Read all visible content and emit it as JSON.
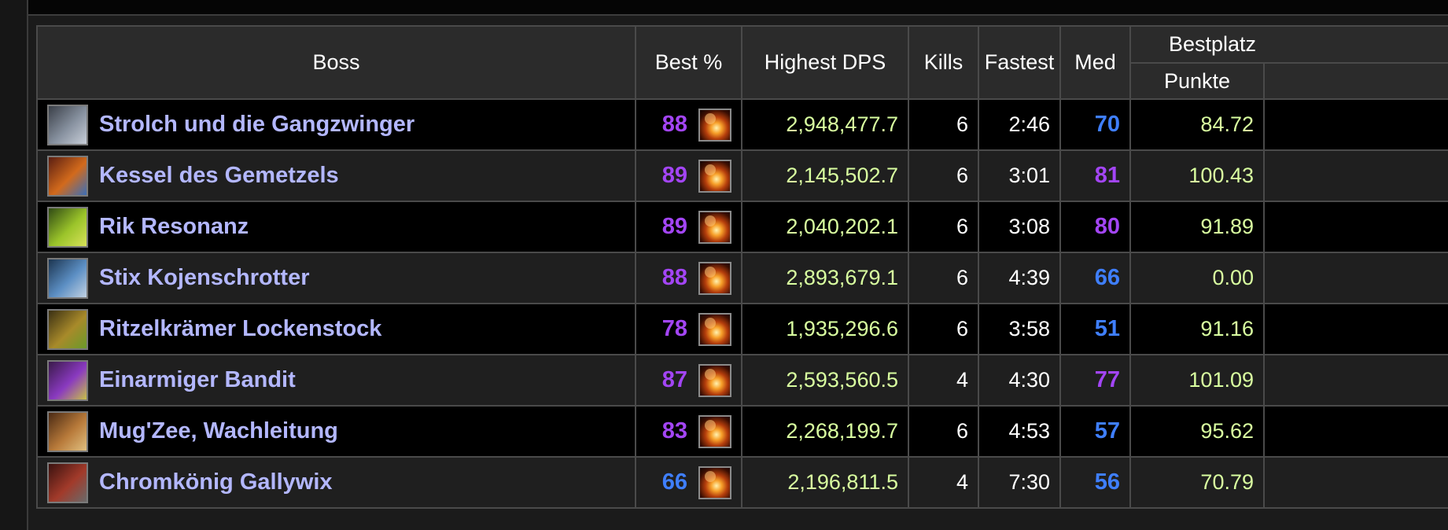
{
  "headers": {
    "boss": "Boss",
    "best_pct": "Best %",
    "highest_dps": "Highest DPS",
    "kills": "Kills",
    "fastest": "Fastest",
    "med": "Med",
    "bestplatz": "Bestplatz",
    "punkte": "Punkte"
  },
  "colors": {
    "purple": "#a345f5",
    "blue": "#3f7fff",
    "name": "#b3b7ff",
    "value": "#d9ffa0"
  },
  "rows": [
    {
      "boss": "Strolch und die Gangzwinger",
      "icon": "boss-portrait-icon",
      "best": "88",
      "best_color": "purple",
      "spell_icon": "fire-spell-icon",
      "dps": "2,948,477.7",
      "kills": "6",
      "fastest": "2:46",
      "med": "70",
      "med_color": "blue",
      "punkte": "84.72"
    },
    {
      "boss": "Kessel des Gemetzels",
      "icon": "boss-portrait-icon",
      "best": "89",
      "best_color": "purple",
      "spell_icon": "fire-spell-icon",
      "dps": "2,145,502.7",
      "kills": "6",
      "fastest": "3:01",
      "med": "81",
      "med_color": "purple",
      "punkte": "100.43"
    },
    {
      "boss": "Rik Resonanz",
      "icon": "boss-portrait-icon",
      "best": "89",
      "best_color": "purple",
      "spell_icon": "fire-spell-icon",
      "dps": "2,040,202.1",
      "kills": "6",
      "fastest": "3:08",
      "med": "80",
      "med_color": "purple",
      "punkte": "91.89"
    },
    {
      "boss": "Stix Kojenschrotter",
      "icon": "boss-portrait-icon",
      "best": "88",
      "best_color": "purple",
      "spell_icon": "fire-spell-icon",
      "dps": "2,893,679.1",
      "kills": "6",
      "fastest": "4:39",
      "med": "66",
      "med_color": "blue",
      "punkte": "0.00"
    },
    {
      "boss": "Ritzelkrämer Lockenstock",
      "icon": "boss-portrait-icon",
      "best": "78",
      "best_color": "purple",
      "spell_icon": "fire-spell-icon",
      "dps": "1,935,296.6",
      "kills": "6",
      "fastest": "3:58",
      "med": "51",
      "med_color": "blue",
      "punkte": "91.16"
    },
    {
      "boss": "Einarmiger Bandit",
      "icon": "boss-portrait-icon",
      "best": "87",
      "best_color": "purple",
      "spell_icon": "fire-spell-icon",
      "dps": "2,593,560.5",
      "kills": "4",
      "fastest": "4:30",
      "med": "77",
      "med_color": "purple",
      "punkte": "101.09"
    },
    {
      "boss": "Mug'Zee, Wachleitung",
      "icon": "boss-portrait-icon",
      "best": "83",
      "best_color": "purple",
      "spell_icon": "fire-spell-icon",
      "dps": "2,268,199.7",
      "kills": "6",
      "fastest": "4:53",
      "med": "57",
      "med_color": "blue",
      "punkte": "95.62"
    },
    {
      "boss": "Chromkönig Gallywix",
      "icon": "boss-portrait-icon",
      "best": "66",
      "best_color": "blue",
      "spell_icon": "fire-spell-icon",
      "dps": "2,196,811.5",
      "kills": "4",
      "fastest": "7:30",
      "med": "56",
      "med_color": "blue",
      "punkte": "70.79"
    }
  ]
}
